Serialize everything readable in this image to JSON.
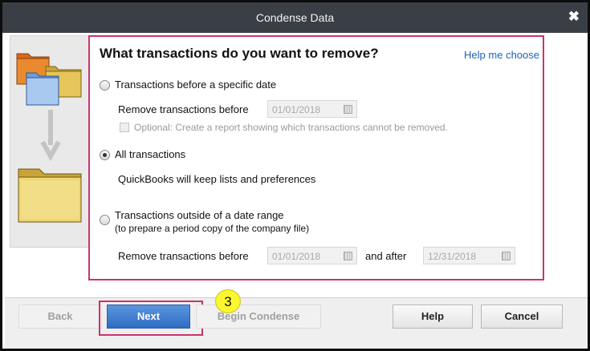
{
  "window": {
    "title": "Condense Data"
  },
  "panel": {
    "heading": "What transactions do you want to remove?",
    "help_link": "Help me choose",
    "option_specific_date": {
      "label": "Transactions before a specific date",
      "selected": false,
      "remove_before_label": "Remove transactions before",
      "date_value": "01/01/2018",
      "optional_report_label": "Optional: Create a report showing which transactions cannot be removed."
    },
    "option_all": {
      "label": "All transactions",
      "selected": true,
      "note": "QuickBooks will keep lists and preferences"
    },
    "option_date_range": {
      "label_line1": "Transactions outside of a date range",
      "label_line2": "(to prepare a period copy of the company file)",
      "selected": false,
      "remove_before_label": "Remove transactions before",
      "before_date": "01/01/2018",
      "and_after_label": "and after",
      "after_date": "12/31/2018"
    }
  },
  "footer": {
    "back_label": "Back",
    "next_label": "Next",
    "begin_condense_label": "Begin Condense",
    "help_label": "Help",
    "cancel_label": "Cancel"
  },
  "annotation": {
    "step_number": "3"
  },
  "colors": {
    "titlebar": "#3a3f46",
    "highlight_border": "#c8346b",
    "link": "#1a62b8",
    "primary_button": "#2f6dc4",
    "step_badge": "#fbf72f"
  },
  "icons": [
    "close-icon",
    "folders-illustration",
    "calendar-icon"
  ]
}
